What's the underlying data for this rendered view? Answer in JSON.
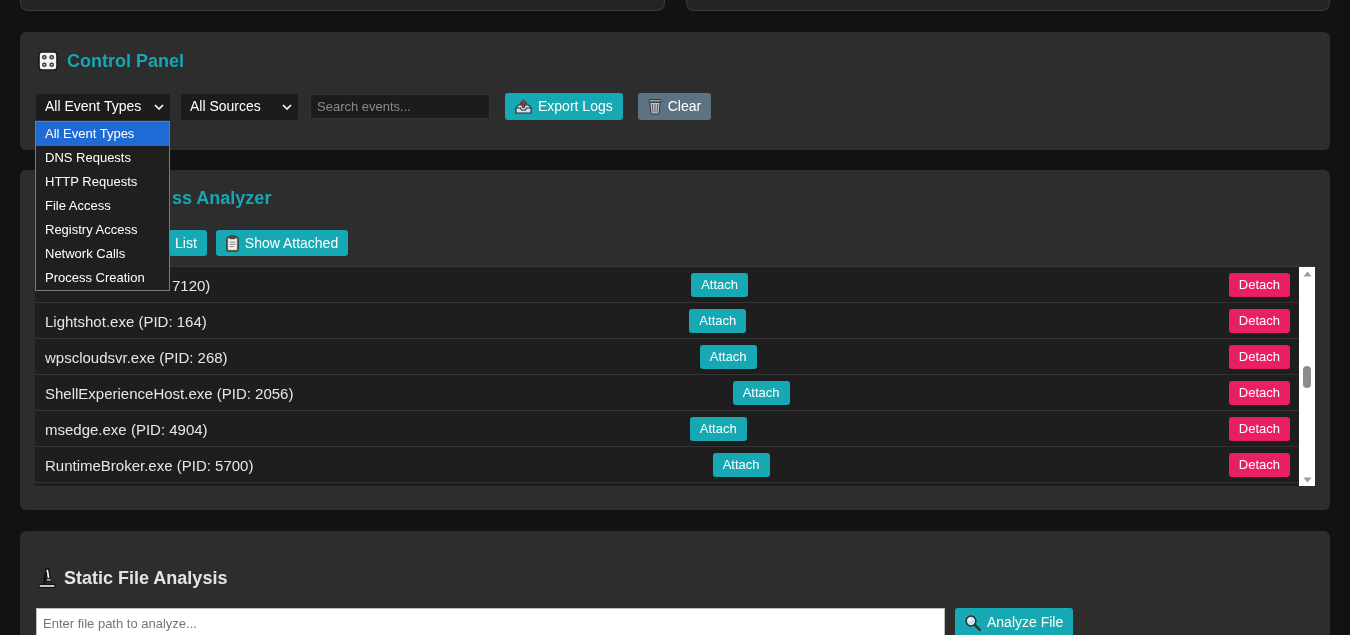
{
  "control_panel": {
    "title": "Control Panel",
    "event_filter": {
      "value": "All Event Types",
      "expanded": true,
      "options": [
        {
          "label": "All Event Types",
          "selected": true
        },
        {
          "label": "DNS Requests",
          "selected": false
        },
        {
          "label": "HTTP Requests",
          "selected": false
        },
        {
          "label": "File Access",
          "selected": false
        },
        {
          "label": "Registry Access",
          "selected": false
        },
        {
          "label": "Network Calls",
          "selected": false
        },
        {
          "label": "Process Creation",
          "selected": false
        }
      ]
    },
    "source_filter": {
      "value": "All Sources"
    },
    "search": {
      "placeholder": "Search events..."
    },
    "buttons": [
      {
        "label": "Export Logs",
        "kind": "export"
      },
      {
        "label": "Clear",
        "kind": "clear"
      }
    ]
  },
  "process_analyzer": {
    "title": "ss Analyzer",
    "buttons": [
      {
        "label": "List",
        "kind": "refresh"
      },
      {
        "label": "Show Attached",
        "kind": "attached"
      }
    ],
    "processes": [
      {
        "name": "7120)",
        "buttons": [
          {
            "label": "Attach",
            "kind": "attach"
          },
          {
            "label": "Detach",
            "kind": "detach"
          }
        ]
      },
      {
        "name": "Lightshot.exe (PID: 164)",
        "buttons": [
          {
            "label": "Attach",
            "kind": "attach"
          },
          {
            "label": "Detach",
            "kind": "detach"
          }
        ]
      },
      {
        "name": "wpscloudsvr.exe (PID: 268)",
        "buttons": [
          {
            "label": "Attach",
            "kind": "attach"
          },
          {
            "label": "Detach",
            "kind": "detach"
          }
        ]
      },
      {
        "name": "ShellExperienceHost.exe (PID: 2056)",
        "buttons": [
          {
            "label": "Attach",
            "kind": "attach"
          },
          {
            "label": "Detach",
            "kind": "detach"
          }
        ]
      },
      {
        "name": "msedge.exe (PID: 4904)",
        "buttons": [
          {
            "label": "Attach",
            "kind": "attach"
          },
          {
            "label": "Detach",
            "kind": "detach"
          }
        ]
      },
      {
        "name": "RuntimeBroker.exe (PID: 5700)",
        "buttons": [
          {
            "label": "Attach",
            "kind": "attach"
          },
          {
            "label": "Detach",
            "kind": "detach"
          }
        ]
      }
    ]
  },
  "static_analysis": {
    "title": "Static File Analysis",
    "file_path": {
      "placeholder": "Enter file path to analyze..."
    },
    "button": {
      "label": "Analyze File",
      "kind": "analyze"
    }
  }
}
